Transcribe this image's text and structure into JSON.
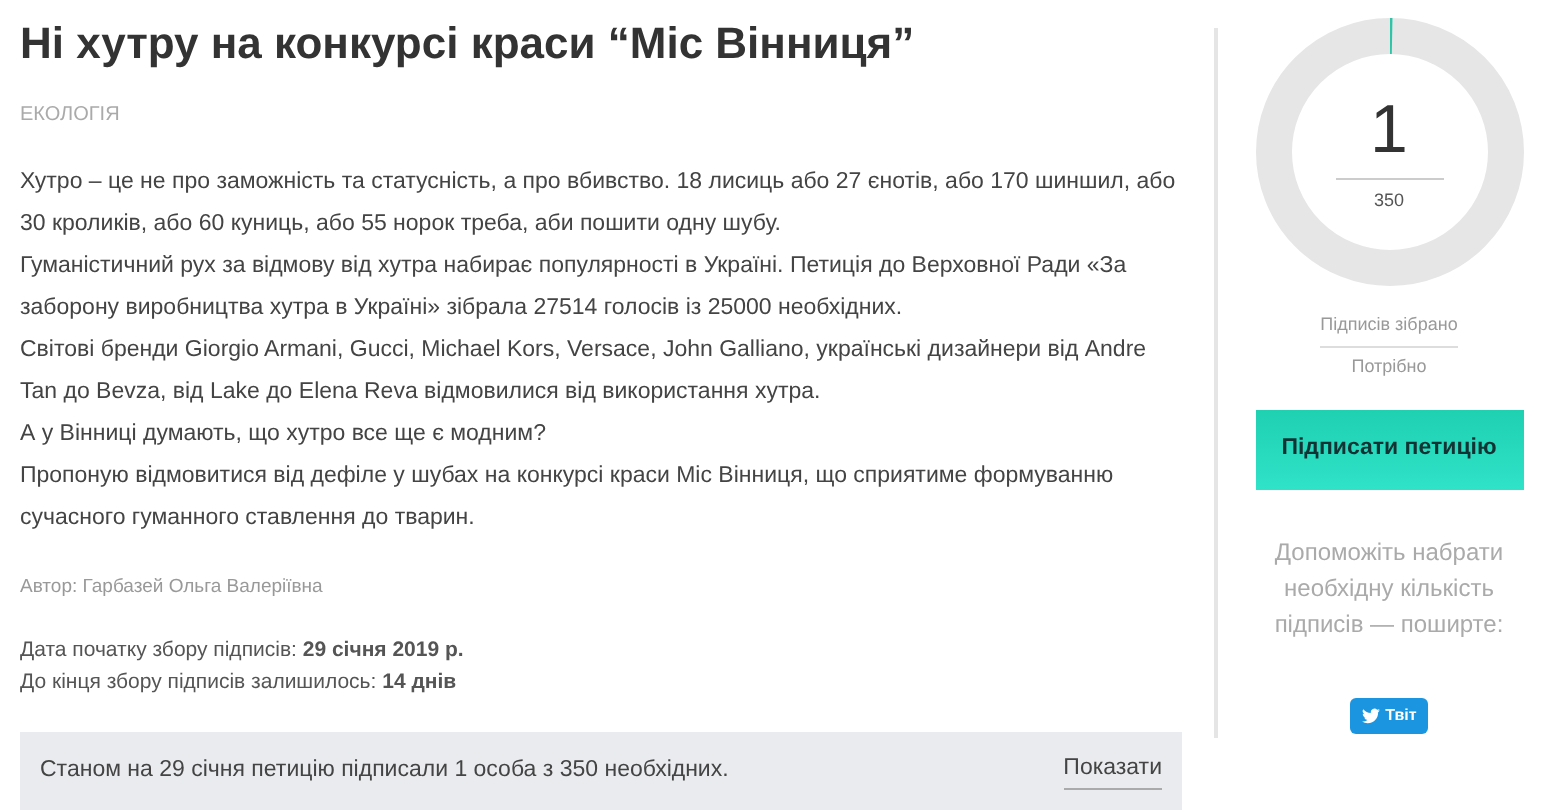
{
  "title": "Ні хутру на конкурсі краси “Міс Вінниця”",
  "category": "ЕКОЛОГІЯ",
  "paragraphs": [
    "Хутро – це не про заможність та статусність, а про вбивство. 18 лисиць або 27 єнотів, або 170 шиншил, або 30 кроликів, або 60 куниць, або 55 норок треба, аби пошити одну шубу.",
    "Гуманістичний рух за відмову від хутра набирає популярності в Україні. Петиція до Верховної Ради «За заборону виробництва хутра в Україні» зібрала 27514 голосів із 25000 необхідних.",
    "Світові бренди Giorgio Armani, Gucci, Michael Kors, Versace, John Galliano, українські дизайнери від Andre Tan до Bevza, від Lake до Elena Reva відмовилися від використання хутра.",
    "А у Вінниці думають, що хутро все ще є модним?",
    "Пропоную відмовитися від дефіле у шубах на конкурсі краси Міс Вінниця, що сприятиме формуванню сучасного гуманного ставлення до тварин."
  ],
  "author": "Автор: Гарбазей Ольга Валеріївна",
  "dates": [
    "Дата початку збору підписів: **29 січня 2019 р.**",
    "До кінця збору підписів залишилось: **14 днів**"
  ],
  "status": {
    "text": "Станом на 29 січня петицію підписали 1 особа з 350 необхідних.",
    "link": "Показати"
  },
  "progress": {
    "collected": "1",
    "needed": "350",
    "level": 0.003,
    "collected_label": "Підписів зібрано",
    "needed_label": "Потрібно"
  },
  "sign_button": "Підписати петицію",
  "share_text": "Допоможіть набрати необхідну кількість підписів — поширте:",
  "tweet_button": "Твіт"
}
